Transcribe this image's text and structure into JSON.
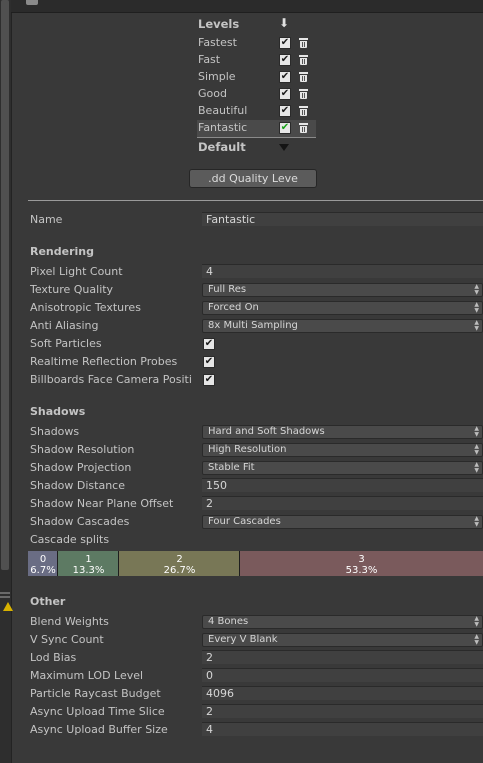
{
  "levels_panel": {
    "title": "Levels",
    "levels": [
      {
        "name": "Fastest",
        "enabled": true
      },
      {
        "name": "Fast",
        "enabled": true
      },
      {
        "name": "Simple",
        "enabled": true
      },
      {
        "name": "Good",
        "enabled": true
      },
      {
        "name": "Beautiful",
        "enabled": true
      },
      {
        "name": "Fantastic",
        "enabled": true
      }
    ],
    "check_glyph": "✔",
    "default_label": "Default",
    "add_button_label": ".dd Quality Leve"
  },
  "name": {
    "label": "Name",
    "value": "Fantastic"
  },
  "rendering": {
    "header": "Rendering",
    "pixel_light_count": {
      "label": "Pixel Light Count",
      "value": "4"
    },
    "texture_quality": {
      "label": "Texture Quality",
      "value": "Full Res"
    },
    "anisotropic_textures": {
      "label": "Anisotropic Textures",
      "value": "Forced On"
    },
    "anti_aliasing": {
      "label": "Anti Aliasing",
      "value": "8x Multi Sampling"
    },
    "soft_particles": {
      "label": "Soft Particles",
      "checked": true
    },
    "realtime_reflection_probes": {
      "label": "Realtime Reflection Probes",
      "checked": true
    },
    "billboards_face_camera": {
      "label": "Billboards Face Camera Positi",
      "checked": true
    }
  },
  "shadows": {
    "header": "Shadows",
    "shadows": {
      "label": "Shadows",
      "value": "Hard and Soft Shadows"
    },
    "shadow_resolution": {
      "label": "Shadow Resolution",
      "value": "High Resolution"
    },
    "shadow_projection": {
      "label": "Shadow Projection",
      "value": "Stable Fit"
    },
    "shadow_distance": {
      "label": "Shadow Distance",
      "value": "150"
    },
    "shadow_near_plane_offset": {
      "label": "Shadow Near Plane Offset",
      "value": "2"
    },
    "shadow_cascades": {
      "label": "Shadow Cascades",
      "value": "Four Cascades"
    },
    "cascade_splits_label": "Cascade splits",
    "cascade_splits": [
      {
        "index": "0",
        "percent": "6.7%",
        "fraction": 0.067,
        "color": "#6a6d84"
      },
      {
        "index": "1",
        "percent": "13.3%",
        "fraction": 0.133,
        "color": "#5d7a63"
      },
      {
        "index": "2",
        "percent": "26.7%",
        "fraction": 0.267,
        "color": "#787756"
      },
      {
        "index": "3",
        "percent": "53.3%",
        "fraction": 0.533,
        "color": "#7a5a5c"
      }
    ]
  },
  "other": {
    "header": "Other",
    "blend_weights": {
      "label": "Blend Weights",
      "value": "4 Bones"
    },
    "v_sync_count": {
      "label": "V Sync Count",
      "value": "Every V Blank"
    },
    "lod_bias": {
      "label": "Lod Bias",
      "value": "2"
    },
    "maximum_lod_level": {
      "label": "Maximum LOD Level",
      "value": "0"
    },
    "particle_raycast_budget": {
      "label": "Particle Raycast Budget",
      "value": "4096"
    },
    "async_upload_time_slice": {
      "label": "Async Upload Time Slice",
      "value": "2"
    },
    "async_upload_buffer_size": {
      "label": "Async Upload Buffer Size",
      "value": "4"
    }
  },
  "icons": {
    "download": "download-arrow-icon",
    "trash": "trash-icon",
    "dropdown": "dropdown-arrows-icon",
    "warning": "warning-icon"
  }
}
